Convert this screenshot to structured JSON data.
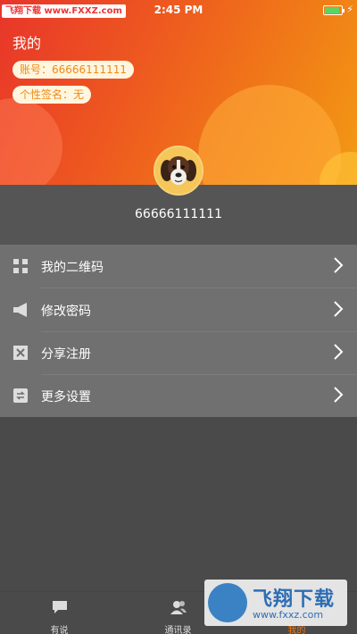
{
  "status_bar": {
    "watermark": "飞翔下载 www.FXXZ.com",
    "time": "2:45 PM"
  },
  "header": {
    "title": "我的",
    "account_pill": "账号：66666111111",
    "signature_pill": "个性签名：无"
  },
  "profile": {
    "username": "66666111111"
  },
  "menu": {
    "items": [
      {
        "label": "我的二维码",
        "icon": "qr-code-icon"
      },
      {
        "label": "修改密码",
        "icon": "megaphone-icon"
      },
      {
        "label": "分享注册",
        "icon": "share-box-icon"
      },
      {
        "label": "更多设置",
        "icon": "refresh-settings-icon"
      }
    ]
  },
  "tabbar": {
    "tabs": [
      {
        "label": "有说",
        "icon": "chat-icon"
      },
      {
        "label": "通讯录",
        "icon": "contacts-icon"
      },
      {
        "label": "我的",
        "icon": "profile-icon"
      }
    ],
    "active_index": 2
  },
  "watermark_bottom": {
    "title": "飞翔下载",
    "url": "www.fxxz.com"
  },
  "colors": {
    "header_start": "#e8352a",
    "header_end": "#f39a14",
    "accent": "#f07a18",
    "menu_bg": "#707070",
    "page_bg": "#4a4a4a"
  }
}
